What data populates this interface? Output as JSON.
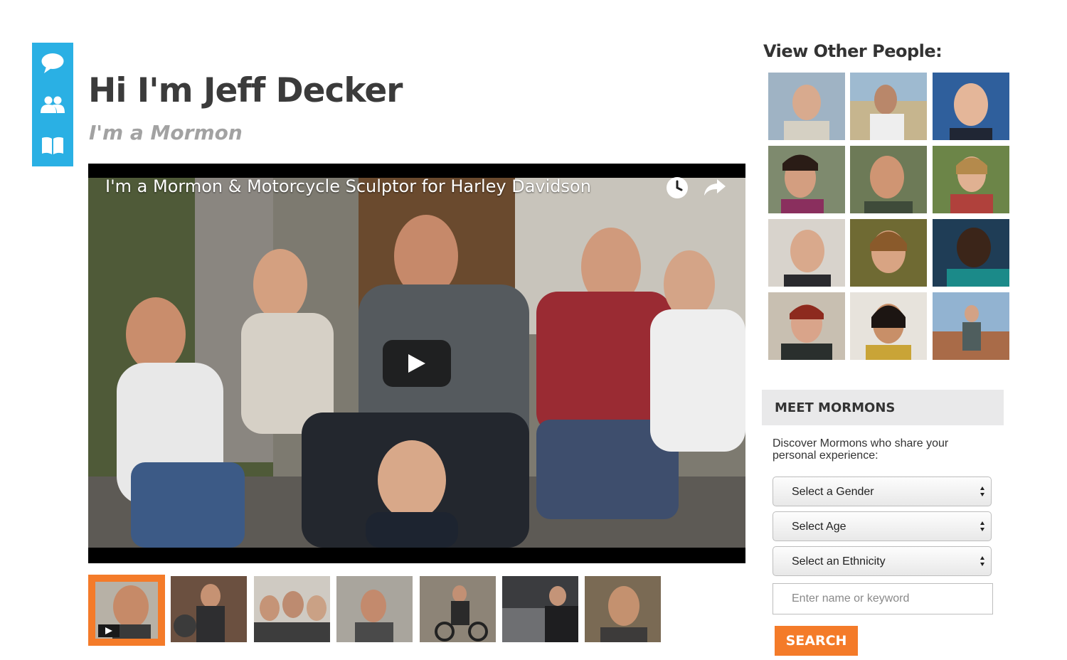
{
  "side_nav": {
    "items": [
      {
        "icon": "chat-bubble-icon"
      },
      {
        "icon": "people-icon"
      },
      {
        "icon": "book-icon"
      }
    ]
  },
  "profile": {
    "title": "Hi I'm Jeff Decker",
    "subtitle": "I'm a Mormon"
  },
  "video": {
    "title": "I'm a Mormon & Motorcycle Sculptor for Harley Davidson",
    "controls": [
      "clock-icon",
      "share-arrow-icon",
      "play-icon"
    ]
  },
  "video_thumbnails": {
    "count": 7,
    "active_index": 0
  },
  "view_others": {
    "title": "View Other People:",
    "count": 12
  },
  "meet_mormons": {
    "title": "MEET MORMONS",
    "description": "Discover Mormons who share your personal experience:",
    "gender_select": "Select a Gender",
    "age_select": "Select Age",
    "ethnicity_select": "Select an Ethnicity",
    "keyword_placeholder": "Enter name or keyword",
    "search_label": "SEARCH"
  },
  "colors": {
    "accent_blue": "#2ab0e4",
    "accent_orange": "#f47b29",
    "panel_gray": "#e9e9ea"
  }
}
